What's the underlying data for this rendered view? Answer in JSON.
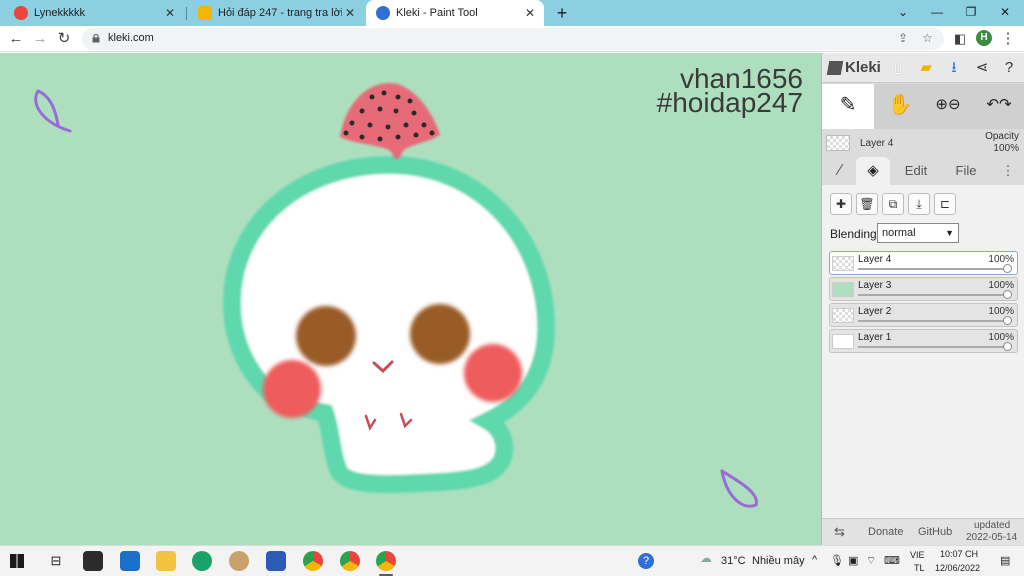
{
  "browser": {
    "tabs": [
      {
        "title": "Lynekkkkk",
        "favicon_color": "#e8453c"
      },
      {
        "title": "Hỏi đáp 247 - trang tra lời",
        "favicon_color": "#f2b705"
      },
      {
        "title": "Kleki - Paint Tool",
        "favicon_color": "#2e6fd8",
        "active": true
      }
    ],
    "new_tab_label": "+",
    "url": "kleki.com",
    "profile_initial": "H"
  },
  "canvas": {
    "background_color": "#addfbf",
    "watermark_line1": "vhan1656",
    "watermark_line2": "#hoidap247"
  },
  "app": {
    "name": "Kleki",
    "current_layer": "Layer 4",
    "opacity_label": "Opacity",
    "opacity_value": "100%",
    "tabs": [
      "Edit",
      "File"
    ],
    "blending_label": "Blending",
    "blending_value": "normal",
    "layers": [
      {
        "name": "Layer 4",
        "opacity": "100%",
        "selected": true,
        "thumb": "checker"
      },
      {
        "name": "Layer 3",
        "opacity": "100%",
        "selected": false,
        "thumb": "green"
      },
      {
        "name": "Layer 2",
        "opacity": "100%",
        "selected": false,
        "thumb": "checker"
      },
      {
        "name": "Layer 1",
        "opacity": "100%",
        "selected": false,
        "thumb": "white"
      }
    ],
    "footer": {
      "donate": "Donate",
      "github": "GitHub",
      "updated_label": "updated",
      "updated_date": "2022-05-14"
    }
  },
  "taskbar": {
    "temperature": "31°C",
    "weather": "Nhiều mây",
    "lang_top": "VIE",
    "lang_bottom": "TL",
    "time": "10:07 CH",
    "date": "12/06/2022"
  }
}
